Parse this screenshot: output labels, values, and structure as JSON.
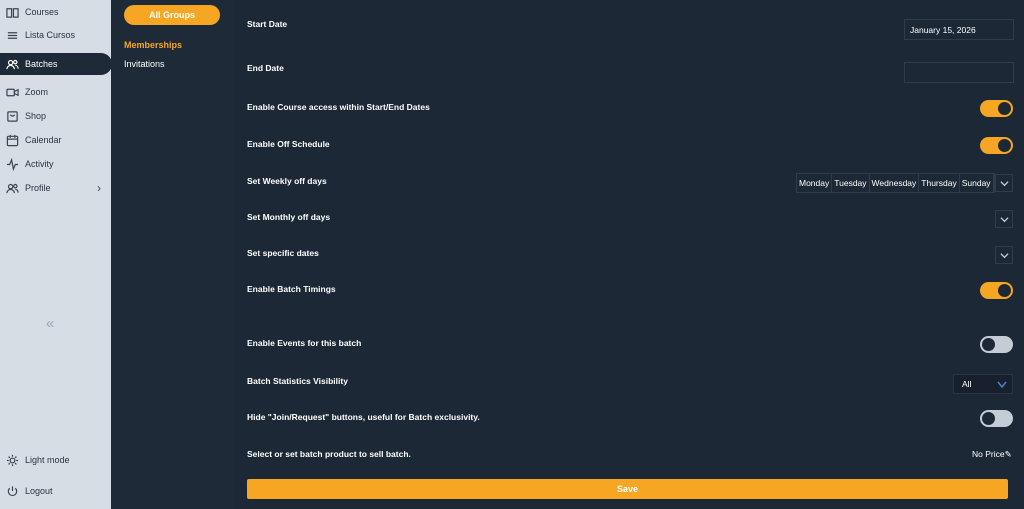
{
  "nav": {
    "items": [
      {
        "label": "Courses",
        "icon": "book-icon"
      },
      {
        "label": "Lista Cursos",
        "icon": "list-icon"
      },
      {
        "label": "Batches",
        "icon": "users-icon"
      },
      {
        "label": "Zoom",
        "icon": "video-icon"
      },
      {
        "label": "Shop",
        "icon": "bag-icon"
      },
      {
        "label": "Calendar",
        "icon": "calendar-icon"
      },
      {
        "label": "Activity",
        "icon": "activity-icon"
      },
      {
        "label": "Profile",
        "icon": "profile-icon"
      }
    ],
    "light_mode": "Light mode",
    "logout": "Logout"
  },
  "groups": {
    "all_groups": "All Groups",
    "memberships": "Memberships",
    "invitations": "Invitations"
  },
  "form": {
    "start_date_label": "Start Date",
    "start_date_value": "January 15, 2026",
    "end_date_label": "End Date",
    "end_date_value": "",
    "course_access_label": "Enable Course access within Start/End Dates",
    "course_access_on": true,
    "off_schedule_label": "Enable Off Schedule",
    "off_schedule_on": true,
    "weekly_off_label": "Set Weekly off days",
    "weekly_off_days": [
      "Monday",
      "Tuesday",
      "Wednesday",
      "Thursday",
      "Sunday"
    ],
    "monthly_off_label": "Set Monthly off days",
    "specific_dates_label": "Set specific dates",
    "batch_timings_label": "Enable Batch Timings",
    "batch_timings_on": true,
    "events_label": "Enable Events for this batch",
    "events_on": false,
    "stats_visibility_label": "Batch Statistics Visibility",
    "stats_visibility_value": "All",
    "hide_join_label": "Hide \"Join/Request\" buttons, useful for Batch exclusivity.",
    "hide_join_on": false,
    "product_label": "Select or set batch product to sell batch.",
    "price_value": "No Price",
    "save_label": "Save"
  },
  "colors": {
    "accent": "#f6a623",
    "background": "#1d2836",
    "nav_bg": "#d6dde5"
  }
}
